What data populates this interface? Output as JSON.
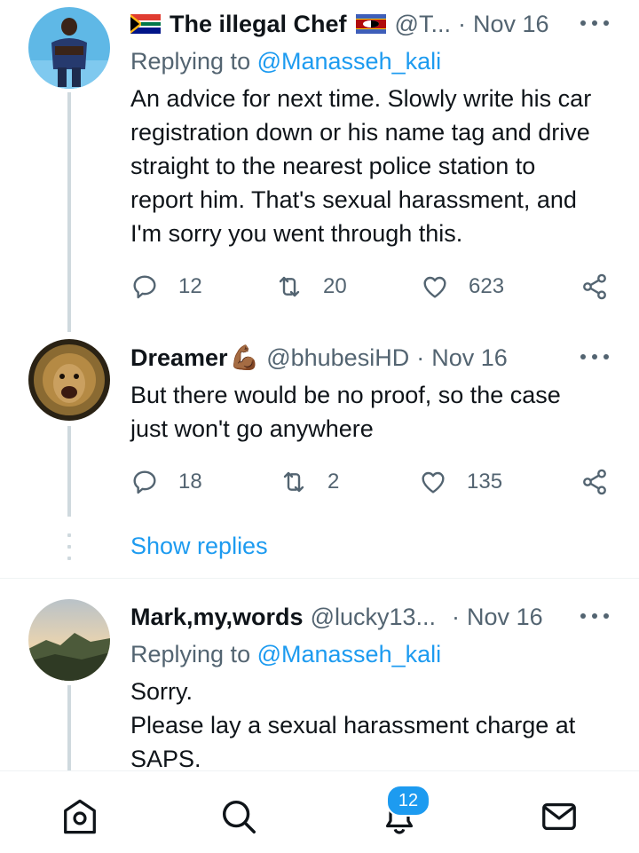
{
  "tweets": [
    {
      "name": "The illegal Chef",
      "handle": "@T...",
      "separator": "·",
      "time": "Nov 16",
      "replying_prefix": "Replying to",
      "replying_mention": "@Manasseh_kali",
      "body_lines": [
        "An advice for next time. Slowly write his car",
        "registration down or his name tag and drive",
        "straight to the nearest police station to",
        "report him. That's sexual harassment, and",
        "I'm sorry you went through this."
      ],
      "replies": "12",
      "retweets": "20",
      "likes": "623"
    },
    {
      "name": "Dreamer",
      "emoji": "💪🏾",
      "handle": "@bhubesiHD",
      "separator": "·",
      "time": "Nov 16",
      "body_lines": [
        "But there would be no proof, so the case",
        "just won't go anywhere"
      ],
      "replies": "18",
      "retweets": "2",
      "likes": "135"
    },
    {
      "name": "Mark,my,words",
      "handle": "@lucky13...",
      "separator": "·",
      "time": "Nov 16",
      "replying_prefix": "Replying to",
      "replying_mention": "@Manasseh_kali",
      "body_lines": [
        "Sorry.",
        "Please lay a sexual harassment charge at",
        "SAPS."
      ]
    }
  ],
  "show_replies": "Show replies",
  "bottom_nav": {
    "notifications_badge": "12"
  },
  "icons": {
    "reply": "reply-icon",
    "retweet": "retweet-icon",
    "like": "heart-icon",
    "share": "share-icon",
    "more": "more-icon",
    "home": "home-icon",
    "search": "search-icon",
    "notifications": "bell-icon",
    "messages": "mail-icon"
  },
  "colors": {
    "accent": "#1d9bf0",
    "text": "#0f1419",
    "muted": "#536471",
    "thread_line": "#cfd9de"
  }
}
